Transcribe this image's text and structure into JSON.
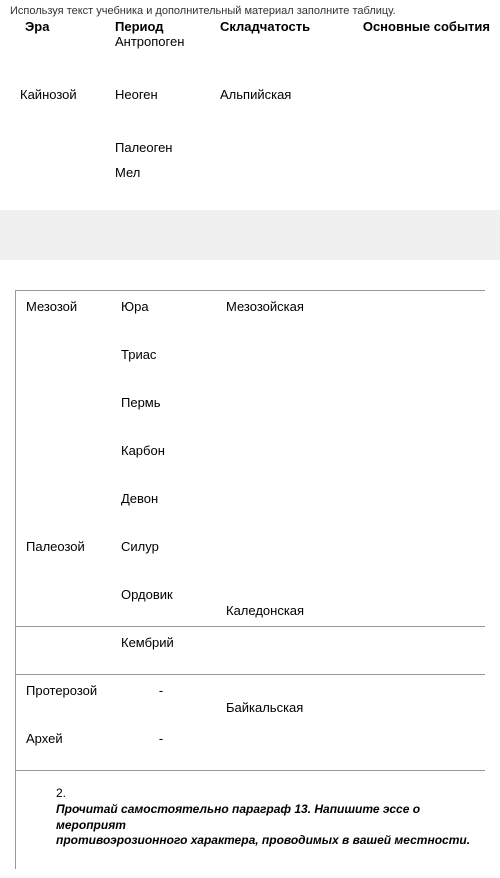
{
  "instruction": "Используя текст учебника и дополнительный материал заполните таблицу.",
  "headers": {
    "era": "Эра",
    "period": "Период",
    "fold": "Складчатость",
    "events": "Основные события"
  },
  "top_rows": [
    {
      "era": "",
      "period": "Антропоген",
      "fold": ""
    },
    {
      "era": "Кайнозой",
      "period": "Неоген",
      "fold": "Альпийская"
    },
    {
      "era": "",
      "period": "Палеоген",
      "fold": ""
    },
    {
      "era": "",
      "period": "Мел",
      "fold": ""
    }
  ],
  "bottom_rows": [
    {
      "era": "Мезозой",
      "period": "Юра",
      "fold": "Мезозойская",
      "border": false
    },
    {
      "era": "",
      "period": "Триас",
      "fold": "",
      "border": false
    },
    {
      "era": "",
      "period": "Пермь",
      "fold": "",
      "border": false
    },
    {
      "era": "",
      "period": "Карбон",
      "fold": "",
      "border": false
    },
    {
      "era": "",
      "period": "Девон",
      "fold": "",
      "border": false
    },
    {
      "era": "Палеозой",
      "period": "Силур",
      "fold": "",
      "border": false
    },
    {
      "era": "",
      "period": "Ордовик",
      "fold": "Каледонская",
      "fold_low": true,
      "border": true
    },
    {
      "era": "",
      "period": "Кембрий",
      "fold": "",
      "border": true
    },
    {
      "era": "Протерозой",
      "period": "-",
      "period_centered": true,
      "fold": "Байкальская",
      "fold_low": true,
      "border": false
    },
    {
      "era": "Архей",
      "period": "-",
      "period_centered": true,
      "fold": "",
      "border": true
    }
  ],
  "task": {
    "number": "2.",
    "text_line1": "Прочитай самостоятельно параграф 13. Напишите эссе о мероприят",
    "text_line2": "противоэрозионного характера, проводимых в вашей местности."
  }
}
